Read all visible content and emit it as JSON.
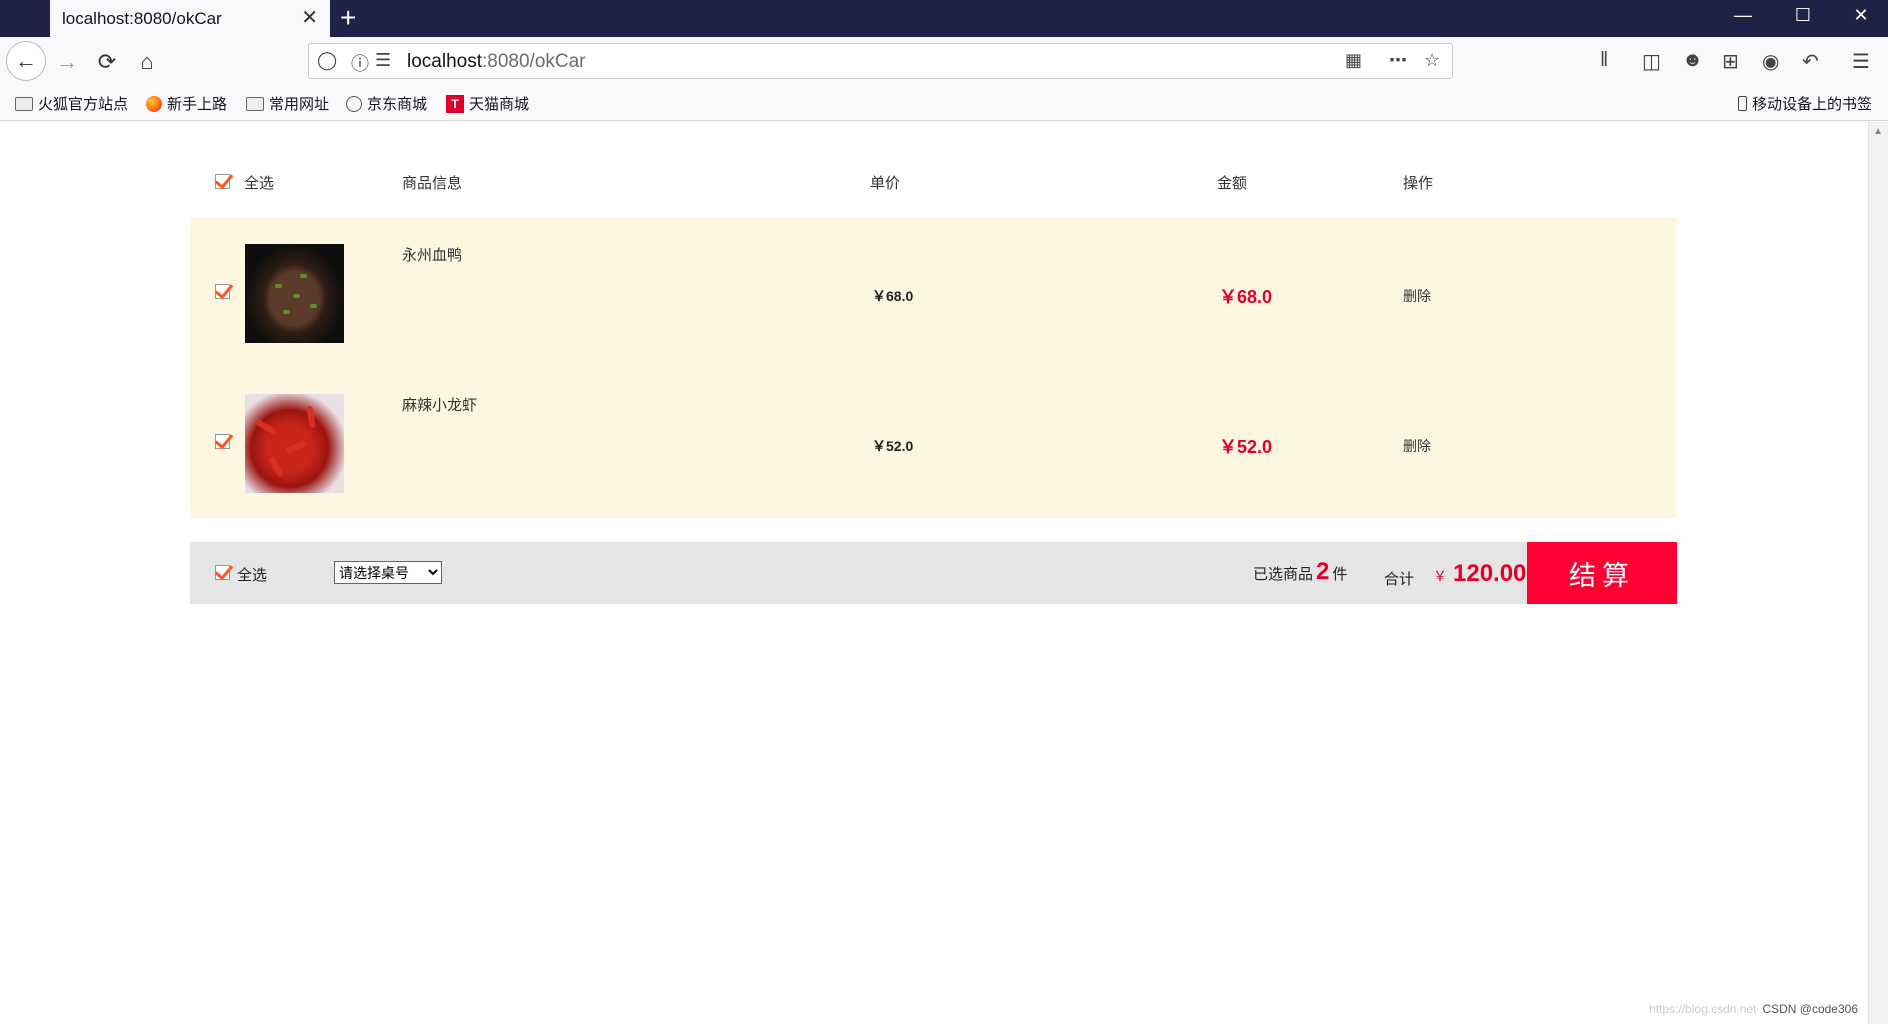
{
  "browser": {
    "tab_title": "localhost:8080/okCar",
    "url_host": "localhost",
    "url_path": ":8080/okCar",
    "bookmarks": [
      "火狐官方站点",
      "新手上路",
      "常用网址",
      "京东商城",
      "天猫商城"
    ],
    "mobile_bookmarks": "移动设备上的书签"
  },
  "cart": {
    "header": {
      "select_all": "全选",
      "product_info": "商品信息",
      "unit_price": "单价",
      "amount": "金额",
      "operation": "操作"
    },
    "items": [
      {
        "name": "永州血鸭",
        "price": "￥68.0",
        "amount": "￥68.0",
        "delete": "删除",
        "checked": true
      },
      {
        "name": "麻辣小龙虾",
        "price": "￥52.0",
        "amount": "￥52.0",
        "delete": "删除",
        "checked": true
      }
    ],
    "footer": {
      "select_all": "全选",
      "table_select_placeholder": "请选择桌号",
      "selected_prefix": "已选商品",
      "selected_count": "2",
      "selected_suffix": "件",
      "total_label": "合计",
      "currency": "￥",
      "total": "120.00",
      "checkout": "结算"
    },
    "accent_color": "#e4002b",
    "row_bg": "#fdf7e1"
  },
  "watermark": {
    "faint": "https://blog.csdn.net",
    "text": "CSDN @code306"
  }
}
